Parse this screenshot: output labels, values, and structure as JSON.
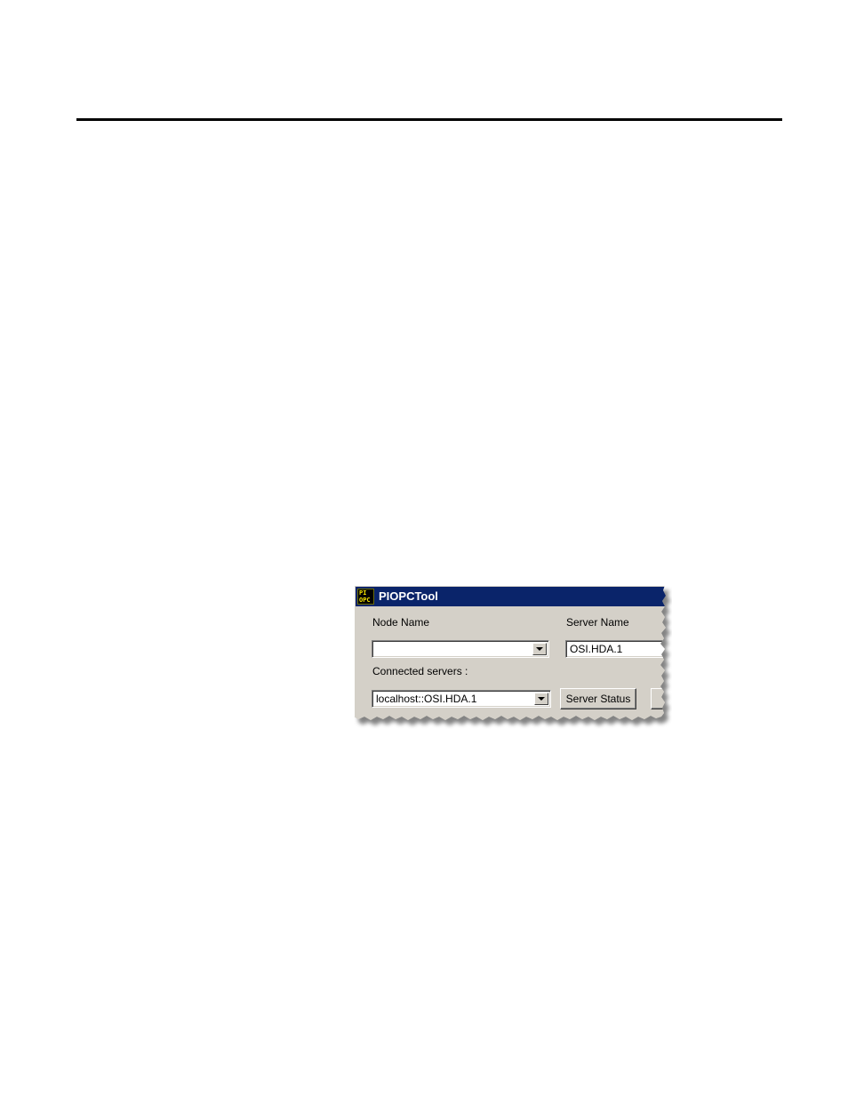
{
  "window": {
    "title": "PIOPCTool",
    "icon_name": "piopc-app-icon",
    "icon_text_top": "PI",
    "icon_text_bottom": "OPC"
  },
  "form": {
    "node_name_label": "Node Name",
    "node_name_value": "",
    "server_name_label": "Server Name",
    "server_name_value": "OSI.HDA.1",
    "connected_servers_label": "Connected servers :",
    "connected_servers_value": "localhost::OSI.HDA.1",
    "server_status_button": "Server Status"
  },
  "colors": {
    "title_bar": "#0a246a",
    "dialog_face": "#d4d0c8",
    "page_rule": "#000000"
  }
}
